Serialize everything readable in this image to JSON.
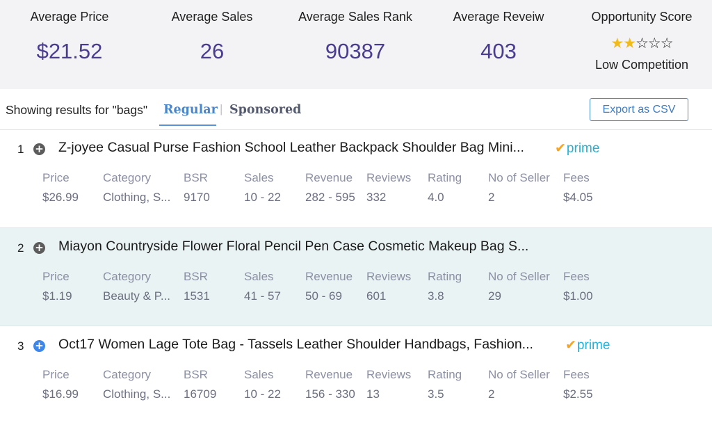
{
  "summary": {
    "metrics": [
      {
        "label": "Average Price",
        "value": "$21.52"
      },
      {
        "label": "Average Sales",
        "value": "26"
      },
      {
        "label": "Average Sales Rank",
        "value": "90387"
      },
      {
        "label": "Average Reveiw",
        "value": "403"
      }
    ],
    "opportunity": {
      "label": "Opportunity Score",
      "rating": 2,
      "max_rating": 5,
      "level": "Low Competition"
    }
  },
  "toolbar": {
    "showing_text": "Showing results for \"bags\"",
    "tabs": [
      {
        "label": "Regular",
        "active": true
      },
      {
        "label": "Sponsored",
        "active": false
      }
    ],
    "separator": "|",
    "export_label": "Export as CSV"
  },
  "columns": [
    "Price",
    "Category",
    "BSR",
    "Sales",
    "Revenue",
    "Reviews",
    "Rating",
    "No of Seller",
    "Fees"
  ],
  "results": [
    {
      "rank": "1",
      "title": "Z-joyee Casual Purse Fashion School Leather Backpack Shoulder Bag Mini...",
      "prime": true,
      "prime_text": "prime",
      "values": [
        "$26.99",
        "Clothing, S...",
        "9170",
        "10 - 22",
        "282 - 595",
        "332",
        "4.0",
        "2",
        "$4.05"
      ]
    },
    {
      "rank": "2",
      "title": "Miayon Countryside Flower Floral Pencil Pen Case Cosmetic Makeup Bag S...",
      "prime": false,
      "prime_text": "",
      "values": [
        "$1.19",
        "Beauty & P...",
        "1531",
        "41 - 57",
        "50 - 69",
        "601",
        "3.8",
        "29",
        "$1.00"
      ]
    },
    {
      "rank": "3",
      "title": "Oct17 Women Lage Tote Bag - Tassels Leather Shoulder Handbags, Fashion...",
      "prime": true,
      "prime_text": "prime",
      "values": [
        "$16.99",
        "Clothing, S...",
        "16709",
        "10 - 22",
        "156 - 330",
        "13",
        "3.5",
        "2",
        "$2.55"
      ]
    }
  ],
  "colors": {
    "accent_blue": "#4a86c9",
    "value_purple": "#4a3c8e",
    "prime_blue": "#25b0d6",
    "prime_check": "#f3a52a",
    "star_gold": "#f2bb1c",
    "alt_row": "#eaf3f4"
  },
  "icons": {
    "expand": "plus-circle-icon",
    "prime_check": "checkmark-icon",
    "star": "star-icon"
  }
}
